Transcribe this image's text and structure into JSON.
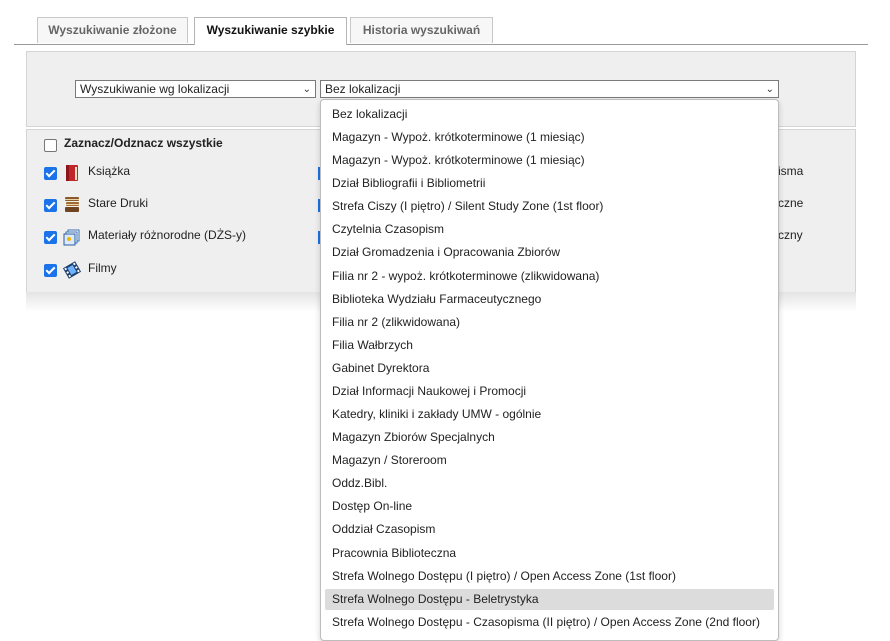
{
  "tabs": [
    {
      "label": "Wyszukiwanie złożone"
    },
    {
      "label": "Wyszukiwanie szybkie"
    },
    {
      "label": "Historia wyszukiwań"
    }
  ],
  "search": {
    "type_select": "Wyszukiwanie wg lokalizacji",
    "location_select": "Bez lokalizacji"
  },
  "types": {
    "select_all": "Zaznacz/Odznacz wszystkie",
    "items": [
      {
        "label": "Książka",
        "checked": true,
        "icon": "book-icon"
      },
      {
        "label": "Stare Druki",
        "checked": true,
        "icon": "old-prints-icon"
      },
      {
        "label": "Materiały różnorodne (DŻS-y)",
        "checked": true,
        "icon": "mixed-materials-icon"
      },
      {
        "label": "Filmy",
        "checked": true,
        "icon": "film-icon"
      }
    ],
    "right_partial": [
      "isma",
      "czne",
      "czny"
    ]
  },
  "dropdown": {
    "highlighted_index": 21,
    "options": [
      "Bez lokalizacji",
      "Magazyn - Wypoż. krótkoterminowe (1 miesiąc)",
      "Magazyn - Wypoż. krótkoterminowe (1 miesiąc)",
      "Dział Bibliografii i Bibliometrii",
      "Strefa Ciszy (I piętro) / Silent Study Zone (1st floor)",
      "Czytelnia Czasopism",
      "Dział Gromadzenia i Opracowania Zbiorów",
      "Filia nr 2 - wypoż. krótkoterminowe (zlikwidowana)",
      "Biblioteka Wydziału Farmaceutycznego",
      "Filia nr 2 (zlikwidowana)",
      "Filia Wałbrzych",
      "Gabinet Dyrektora",
      "Dział Informacji Naukowej i Promocji",
      "Katedry, kliniki i zakłady UMW - ogólnie",
      "Magazyn Zbiorów Specjalnych",
      "Magazyn / Storeroom",
      "Oddz.Bibl.",
      "Dostęp On-line",
      "Oddział Czasopism",
      "Pracownia Biblioteczna",
      "Strefa Wolnego Dostępu (I piętro) / Open Access Zone (1st floor)",
      "Strefa Wolnego Dostępu - Beletrystyka",
      "Strefa Wolnego Dostępu - Czasopisma (II piętro) / Open Access Zone (2nd floor)"
    ]
  }
}
